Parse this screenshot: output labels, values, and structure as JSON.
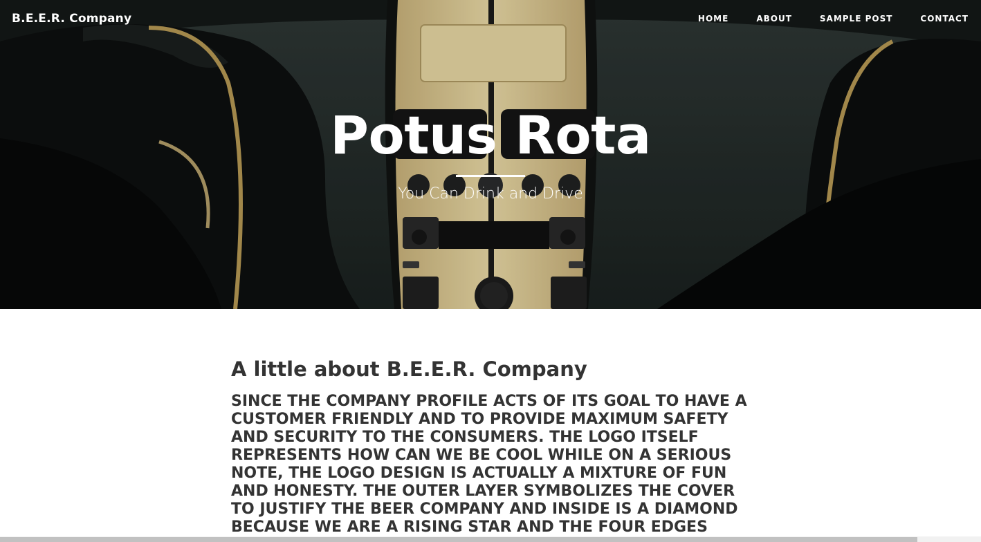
{
  "header": {
    "brand": "B.E.E.R. Company",
    "nav": [
      "HOME",
      "ABOUT",
      "SAMPLE POST",
      "CONTACT"
    ]
  },
  "hero": {
    "title": "Potus Rota",
    "subtitle": "You Can Drink and Drive"
  },
  "main": {
    "heading": "A little about B.E.E.R. Company",
    "body": "SINCE THE COMPANY PROFILE ACTS OF ITS GOAL TO HAVE A CUSTOMER FRIENDLY AND TO PROVIDE MAXIMUM SAFETY AND SECURITY TO THE CONSUMERS. THE LOGO ITSELF REPRESENTS HOW CAN WE BE COOL WHILE ON A SERIOUS NOTE, THE LOGO DESIGN IS ACTUALLY A MIXTURE OF FUN AND HONESTY. THE OUTER LAYER SYMBOLIZES THE COVER TO JUSTIFY THE BEER COMPANY AND INSIDE IS A DIAMOND BECAUSE WE ARE A RISING STAR AND THE FOUR EDGES"
  },
  "colors": {
    "text_dark": "#333333",
    "hero_text": "#ffffff",
    "wood": "#e4cf96"
  }
}
